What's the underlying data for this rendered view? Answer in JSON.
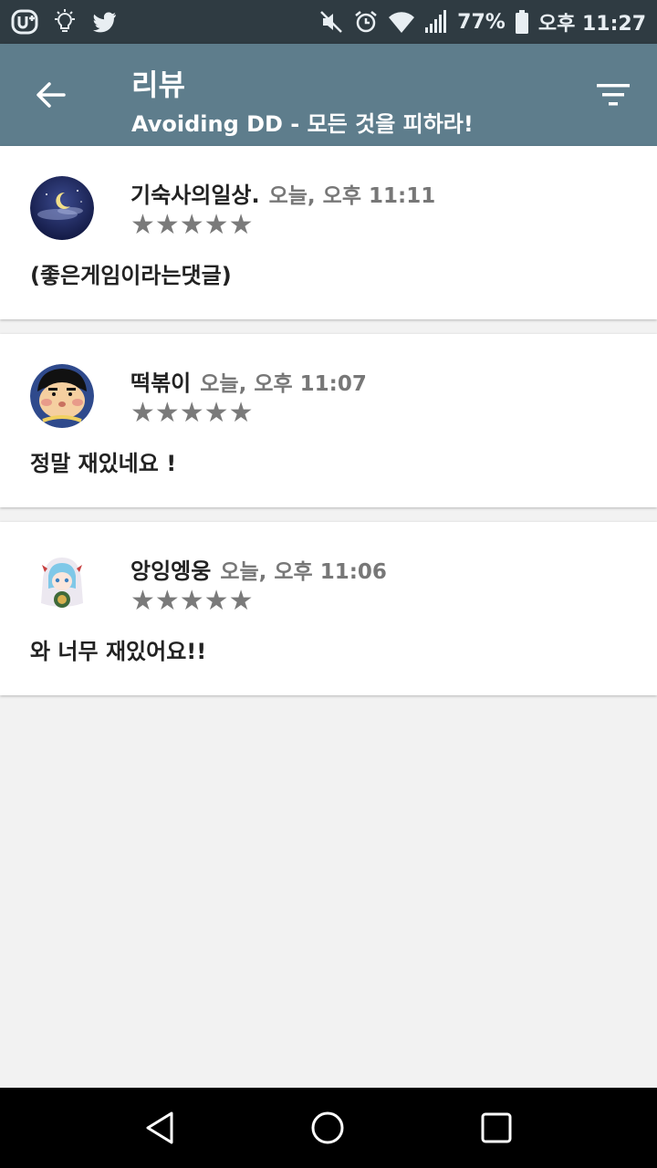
{
  "status_bar": {
    "icons_left": [
      "u-plus-icon",
      "lightbulb-icon",
      "twitter-icon"
    ],
    "icons_right": [
      "mute-icon",
      "alarm-icon",
      "wifi-icon",
      "signal-icon",
      "battery-icon"
    ],
    "battery": "77%",
    "time": "오후 11:27"
  },
  "app_bar": {
    "title": "리뷰",
    "subtitle": "Avoiding DD - 모든 것을 피하라!",
    "back_icon": "arrow-back-icon",
    "filter_icon": "filter-icon",
    "color": "#5e7d8c"
  },
  "reviews": [
    {
      "name": "기숙사의일상.",
      "time": "오늘, 오후 11:11",
      "stars": "★★★★★",
      "rating": 5,
      "text": "(좋은게임이라는댓글)",
      "avatar": "night-moon-avatar"
    },
    {
      "name": "떡볶이",
      "time": "오늘, 오후 11:07",
      "stars": "★★★★★",
      "rating": 5,
      "text": "정말 재있네요 !",
      "avatar": "cartoon-boy-avatar"
    },
    {
      "name": "앙잉엥웅",
      "time": "오늘, 오후 11:06",
      "stars": "★★★★★",
      "rating": 5,
      "text": "와 너무 재있어요!!",
      "avatar": "anime-girl-avatar"
    }
  ],
  "nav_bar": {
    "buttons": [
      "back-triangle-icon",
      "home-circle-icon",
      "recents-square-icon"
    ]
  }
}
